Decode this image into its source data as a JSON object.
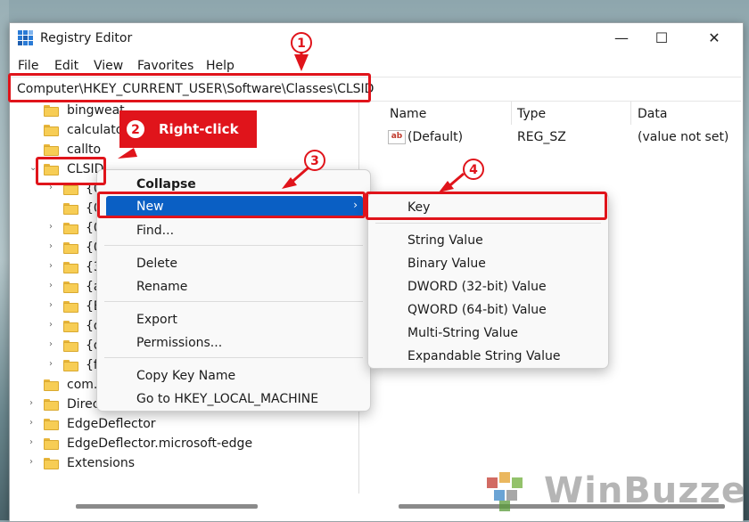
{
  "window": {
    "title": "Registry Editor",
    "minimize": "—",
    "maximize": "☐",
    "close": "✕"
  },
  "menu": [
    "File",
    "Edit",
    "View",
    "Favorites",
    "Help"
  ],
  "address": "Computer\\HKEY_CURRENT_USER\\Software\\Classes\\CLSID",
  "tree": {
    "above": [
      "bingweat",
      "calculato",
      "callto"
    ],
    "selected": "CLSID",
    "children": [
      "{0",
      "{0",
      "{0",
      "{0",
      "{3",
      "{a",
      "{B",
      "{d",
      "{d",
      "{f8"
    ],
    "below": [
      "com.r",
      "Direc",
      "EdgeDeflector",
      "EdgeDeflector.microsoft-edge",
      "Extensions"
    ]
  },
  "values": {
    "columns": [
      "Name",
      "Type",
      "Data"
    ],
    "rows": [
      {
        "name": "(Default)",
        "type": "REG_SZ",
        "data": "(value not set)",
        "icon": "string-value-icon"
      }
    ]
  },
  "context_menu": {
    "items": [
      "Collapse",
      "New",
      "Find...",
      "Delete",
      "Rename",
      "Export",
      "Permissions...",
      "Copy Key Name",
      "Go to HKEY_LOCAL_MACHINE"
    ]
  },
  "submenu": {
    "items": [
      "Key",
      "String Value",
      "Binary Value",
      "DWORD (32-bit) Value",
      "QWORD (64-bit) Value",
      "Multi-String Value",
      "Expandable String Value"
    ]
  },
  "annotations": {
    "step1": "1",
    "step2": "2",
    "step2_label": "Right-click",
    "step3": "3",
    "step4": "4",
    "color": "#e0141b"
  },
  "watermark": "WinBuzzer",
  "colors": {
    "highlight": "#0a5fc4",
    "folder": "#f7cd55"
  }
}
